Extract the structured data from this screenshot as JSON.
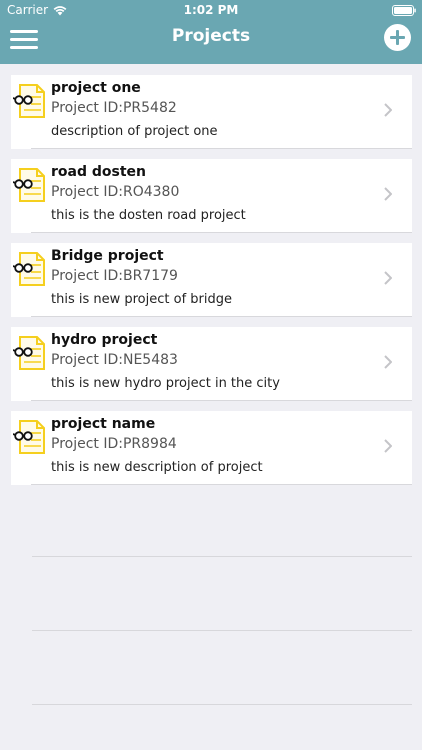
{
  "status_bar": {
    "carrier": "Carrier",
    "time": "1:02 PM"
  },
  "nav": {
    "title": "Projects",
    "menu_icon": "hamburger-menu-icon",
    "add_icon": "plus-circle-icon"
  },
  "colors": {
    "header": "#6aa7b2",
    "background": "#efeff4",
    "icon_yellow": "#f5cf1e"
  },
  "projects": [
    {
      "name": "project one",
      "id_label": "Project ID:PR5482",
      "description": "description of project one"
    },
    {
      "name": "road dosten",
      "id_label": "Project ID:RO4380",
      "description": "this is the dosten road project"
    },
    {
      "name": "Bridge project",
      "id_label": "Project ID:BR7179",
      "description": "this is new project of bridge"
    },
    {
      "name": "hydro project",
      "id_label": "Project ID:NE5483",
      "description": "this is new hydro project in the city"
    },
    {
      "name": "project name",
      "id_label": "Project ID:PR8984",
      "description": "this is new description of project"
    }
  ]
}
